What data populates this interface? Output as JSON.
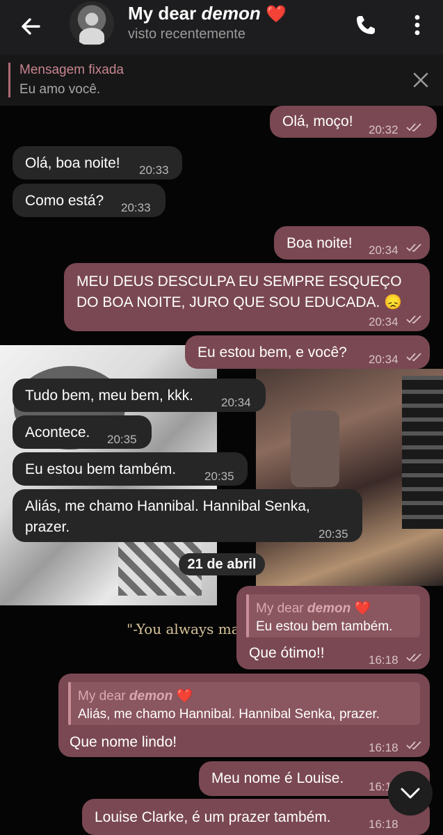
{
  "header": {
    "title_prefix": "My dear ",
    "title_em": "demon",
    "title_heart": "❤️",
    "status": "visto recentemente"
  },
  "pinned": {
    "label": "Mensagem fixada",
    "text": "Eu amo você."
  },
  "wallpaper": {
    "quote": "\"-You always ma"
  },
  "messages": [
    {
      "side": "out",
      "text": "Olá, moço!",
      "time": "20:32"
    },
    {
      "side": "in",
      "text": "Olá, boa noite!",
      "time": "20:33"
    },
    {
      "side": "in",
      "text": "Como está?",
      "time": "20:33"
    },
    {
      "side": "out",
      "text": "Boa noite!",
      "time": "20:34"
    },
    {
      "side": "out",
      "line1": "MEU DEUS DESCULPA EU SEMPRE ESQUEÇO",
      "line2": "DO BOA NOITE, JURO QUE SOU EDUCADA. 😞",
      "time": "20:34"
    },
    {
      "side": "out",
      "text": "Eu estou bem, e você?",
      "time": "20:34"
    },
    {
      "side": "in",
      "text": "Tudo bem, meu bem, kkk.",
      "time": "20:34"
    },
    {
      "side": "in",
      "text": "Acontece.",
      "time": "20:35"
    },
    {
      "side": "in",
      "text": "Eu estou bem também.",
      "time": "20:35"
    },
    {
      "side": "in",
      "line1": "Aliás, me chamo Hannibal. Hannibal Senka,",
      "line2": "prazer.",
      "time": "20:35"
    },
    {
      "side": "out",
      "reply_name": "My dear ",
      "reply_name_em": "demon",
      "reply_heart": "❤️",
      "reply_text": "Eu estou bem também.",
      "text": "Que ótimo!!",
      "time": "16:18"
    },
    {
      "side": "out",
      "reply_name": "My dear ",
      "reply_name_em": "demon",
      "reply_heart": "❤️",
      "reply_text": "Aliás, me chamo Hannibal. Hannibal Senka, prazer.",
      "text": "Que nome lindo!",
      "time": "16:18"
    },
    {
      "side": "out",
      "text": "Meu nome é Louise.",
      "time": "16:1"
    },
    {
      "side": "out",
      "text": "Louise Clarke, é um prazer também.",
      "time": "16:18"
    }
  ],
  "date_separator": "21 de abril",
  "colors": {
    "header_bg": "#1d1d1f",
    "incoming_bubble": "#262626",
    "outgoing_bubble": "#7a4852",
    "pinned_accent": "#c78490"
  },
  "icons": {
    "back": "arrow-left",
    "call": "phone",
    "menu": "vertical-dots",
    "close": "x",
    "scroll_down": "chevron-down",
    "read": "double-check"
  }
}
